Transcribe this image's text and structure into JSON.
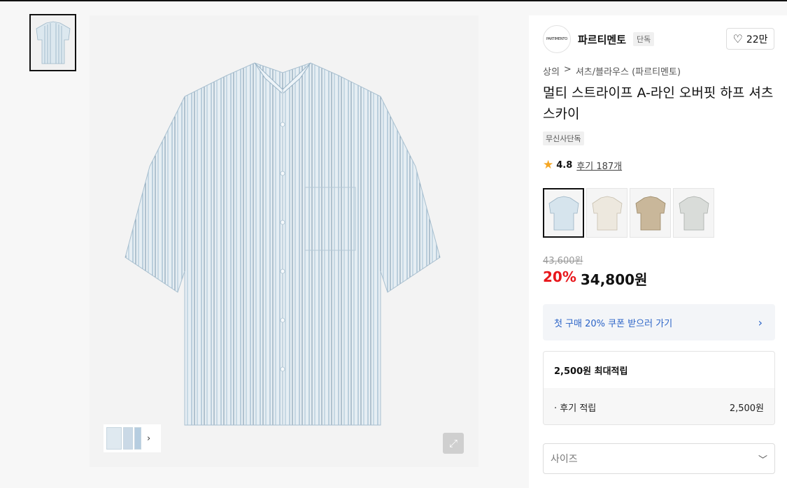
{
  "gallery": {
    "expand_icon": "expand-icon",
    "more_icon": "chevron-right-icon"
  },
  "brand": {
    "logo_text": "PARTIMENTO",
    "name": "파르티멘토",
    "badge": "단독",
    "like_count": "22만"
  },
  "breadcrumb": {
    "level1": "상의",
    "separator": ">",
    "level2": "셔츠/블라우스 (파르티멘토)"
  },
  "product": {
    "title": "멀티 스트라이프 A-라인 오버핏 하프 셔츠 스카이",
    "tag": "무신사단독",
    "rating": "4.8",
    "review_link": "후기 187개"
  },
  "colors": {
    "options": [
      "sky",
      "ivory",
      "beige",
      "grey"
    ],
    "selected": "sky"
  },
  "pricing": {
    "original": "43,600원",
    "discount": "20%",
    "price": "34,800원"
  },
  "coupon": {
    "label": "첫 구매 20% 쿠폰 받으러 가기",
    "arrow": "›"
  },
  "points": {
    "title": "2,500원 최대적립",
    "row_label": "· 후기 적립",
    "row_value": "2,500원"
  },
  "size": {
    "placeholder": "사이즈"
  }
}
